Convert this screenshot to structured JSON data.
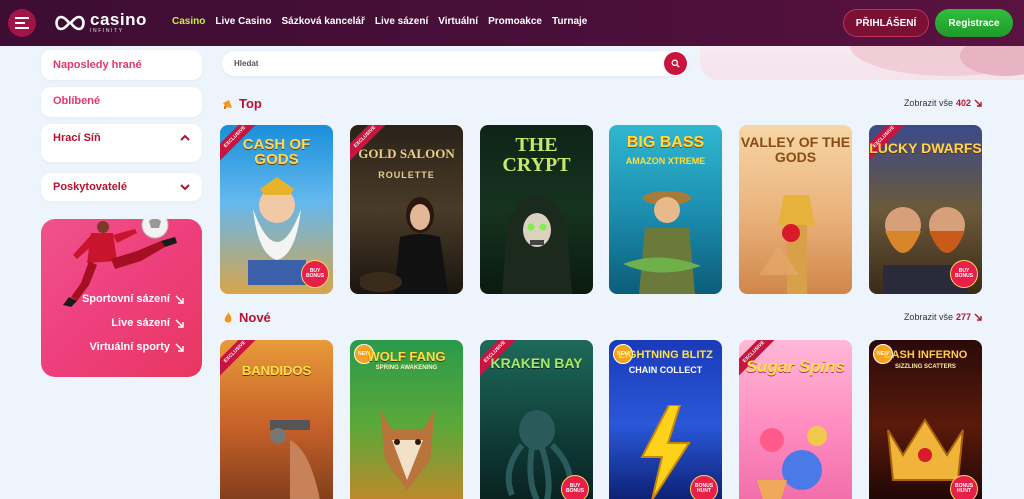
{
  "header": {
    "logo_main": "casino",
    "logo_sub": "INFINITY",
    "nav": [
      "Casino",
      "Live Casino",
      "Sázková kancelář",
      "Live sázení",
      "Virtuální",
      "Promoakce",
      "Turnaje"
    ],
    "login_label": "PŘIHLÁŠENÍ",
    "register_label": "Registrace"
  },
  "sidebar": {
    "recent": "Naposledy hrané",
    "favorites": "Oblíbené",
    "gaming_hall": "Hrací Síň",
    "providers": "Poskytovatelé",
    "promo_links": [
      "Sportovní sázení",
      "Live sázení",
      "Virtuální sporty"
    ]
  },
  "search": {
    "placeholder": "Hledat"
  },
  "sections": {
    "top": {
      "title": "Top",
      "show_all": "Zobrazit vše",
      "count": "402"
    },
    "new": {
      "title": "Nové",
      "show_all": "Zobrazit vše",
      "count": "277"
    }
  },
  "games_top": [
    {
      "name": "CASH OF GODS",
      "badge": "EXCLUSIVE",
      "bonus": "BUY BONUS"
    },
    {
      "name": "GOLD SALOON",
      "sub": "ROULETTE",
      "badge": "EXCLUSIVE"
    },
    {
      "name": "THE CRYPT"
    },
    {
      "name": "BIG BASS",
      "sub": "AMAZON XTREME"
    },
    {
      "name": "VALLEY OF THE GODS"
    },
    {
      "name": "LUCKY DWARFS",
      "badge": "EXCLUSIVE",
      "bonus": "BUY BONUS"
    }
  ],
  "games_new": [
    {
      "name": "BANDIDOS",
      "badge": "EXCLUSIVE"
    },
    {
      "name": "WOLF FANG",
      "sub": "SPRING AWAKENING",
      "badge": "NEW"
    },
    {
      "name": "KRAKEN BAY",
      "badge": "EXCLUSIVE",
      "bonus": "BUY BONUS"
    },
    {
      "name": "LIGHTNING BLITZ",
      "sub": "CHAIN COLLECT",
      "badge": "NEW",
      "bonus": "BONUS HUNT"
    },
    {
      "name": "Sugar Spins",
      "badge": "EXCLUSIVE"
    },
    {
      "name": "CASH INFERNO",
      "sub": "SIZZLING SCATTERS",
      "badge": "NEW",
      "bonus": "BONUS HUNT"
    }
  ],
  "colors": {
    "accent": "#b5132f",
    "nav_active": "#c8f03c",
    "header_bg": "#3d0d33",
    "register": "#2fbf3b"
  }
}
